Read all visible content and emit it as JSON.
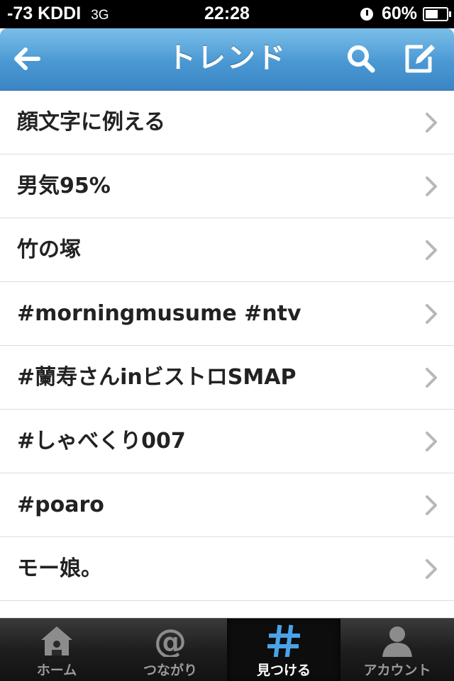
{
  "status_bar": {
    "signal": "-73 KDDI",
    "network": "3G",
    "time": "22:28",
    "battery": "60%",
    "battery_level": 0.6
  },
  "nav": {
    "title": "トレンド",
    "back_icon": "arrow-left-icon",
    "search_icon": "search-icon",
    "compose_icon": "compose-icon"
  },
  "trends": [
    {
      "label": "顔文字に例える"
    },
    {
      "label": "男気95%"
    },
    {
      "label": "竹の塚"
    },
    {
      "label": "#morningmusume #ntv"
    },
    {
      "label": "#蘭寿さんinビストロSMAP"
    },
    {
      "label": "#しゃべくり007"
    },
    {
      "label": "#poaro"
    },
    {
      "label": "モー娘。"
    }
  ],
  "tabs": [
    {
      "label": "ホーム",
      "icon": "home-icon"
    },
    {
      "label": "つながり",
      "icon": "at-icon"
    },
    {
      "label": "見つける",
      "icon": "hashtag-icon",
      "active": true
    },
    {
      "label": "アカウント",
      "icon": "person-icon"
    }
  ],
  "colors": {
    "nav_accent": "#4a98d3",
    "active_tab_icon": "#4aa3e8"
  }
}
